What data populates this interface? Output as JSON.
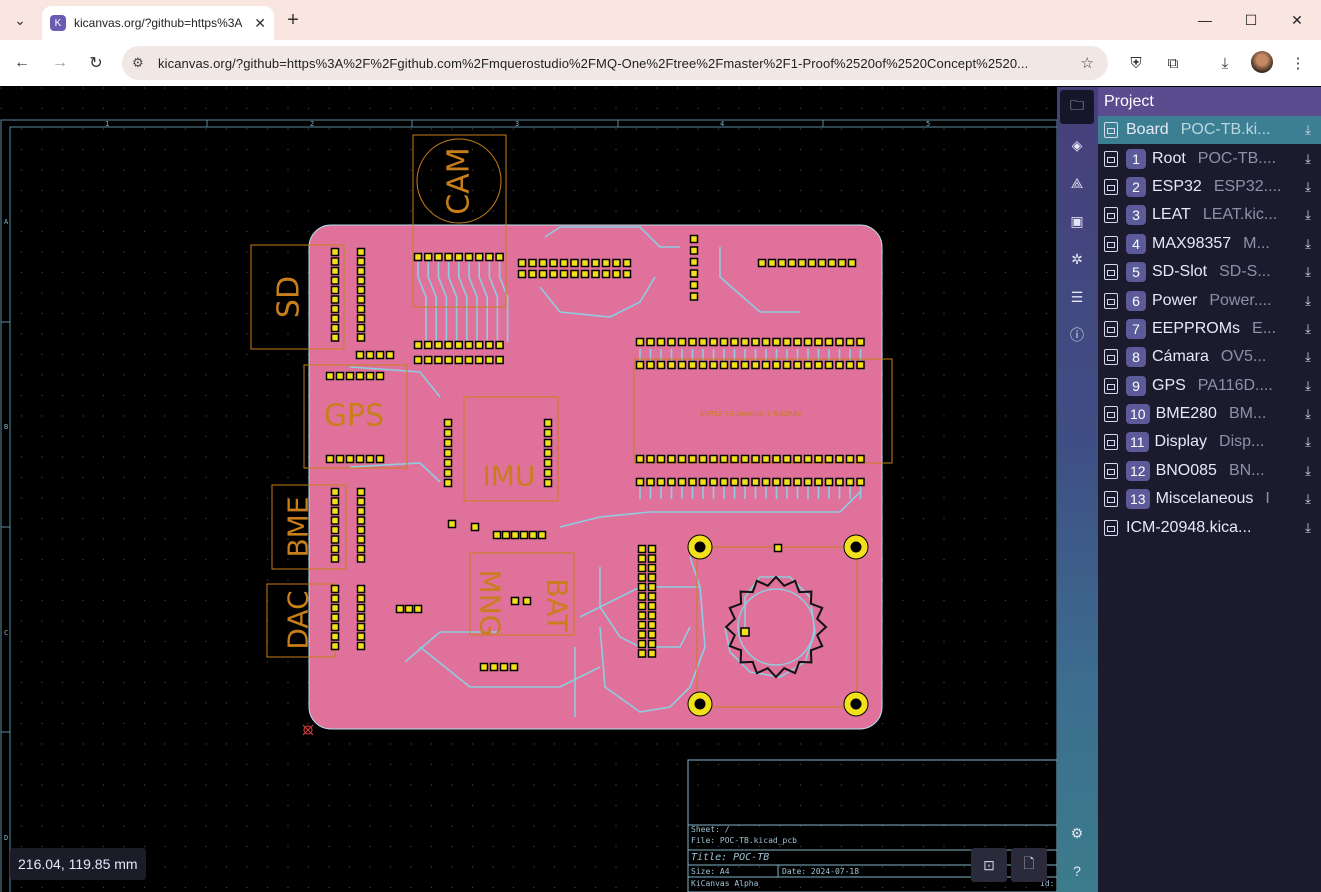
{
  "browser": {
    "tab_title": "kicanvas.org/?github=https%3A",
    "tab_favicon": "K",
    "url": "kicanvas.org/?github=https%3A%2F%2Fgithub.com%2Fmquerostudio%2FMQ-One%2Ftree%2Fmaster%2F1-Proof%2520of%2520Concept%2520...",
    "new_tab_label": "+"
  },
  "board": {
    "silkscreen_labels": {
      "cam": "CAM",
      "sd": "SD",
      "gps": "GPS",
      "imu": "IMU",
      "bme": "BME",
      "dac": "DAC",
      "mng": "MNG",
      "bat": "BAT",
      "esp": "ESP32-S3-DevKitC-1-N32R8V"
    },
    "frame_cols": [
      "1",
      "2",
      "3",
      "4",
      "5"
    ],
    "frame_rows": [
      "A",
      "B",
      "C",
      "D"
    ],
    "colors": {
      "board_fill": "#e0719a",
      "courtyard": "#c87e1a",
      "pad": "#f2e01a",
      "trace": "#8ecde0",
      "frame": "#7fb3c8"
    }
  },
  "title_block": {
    "sheet": "Sheet: /",
    "file": "File: POC-TB.kicad_pcb",
    "title": "Title: POC-TB",
    "size": "Size: A4",
    "date": "Date: 2024-07-18",
    "app": "KiCanvas Alpha",
    "id": "Id:"
  },
  "status": {
    "coordinates": "216.04, 119.85 mm"
  },
  "panel": {
    "header": "Project",
    "rows": [
      {
        "num": "",
        "name": "Board",
        "file": "POC-TB.ki..."
      },
      {
        "num": "1",
        "name": "Root",
        "file": "POC-TB...."
      },
      {
        "num": "2",
        "name": "ESP32",
        "file": "ESP32...."
      },
      {
        "num": "3",
        "name": "LEAT",
        "file": "LEAT.kic..."
      },
      {
        "num": "4",
        "name": "MAX98357",
        "file": "M..."
      },
      {
        "num": "5",
        "name": "SD-Slot",
        "file": "SD-S..."
      },
      {
        "num": "6",
        "name": "Power",
        "file": "Power...."
      },
      {
        "num": "7",
        "name": "EEPPROMs",
        "file": "E..."
      },
      {
        "num": "8",
        "name": "Cámara",
        "file": "OV5..."
      },
      {
        "num": "9",
        "name": "GPS",
        "file": "PA116D...."
      },
      {
        "num": "10",
        "name": "BME280",
        "file": "BM..."
      },
      {
        "num": "11",
        "name": "Display",
        "file": "Disp..."
      },
      {
        "num": "12",
        "name": "BNO085",
        "file": "BN..."
      },
      {
        "num": "13",
        "name": "Miscelaneous",
        "file": "I"
      },
      {
        "num": "",
        "name": "ICM-20948.kica...",
        "file": ""
      }
    ]
  },
  "rail_icons": [
    "folder-icon",
    "layers-icon",
    "objects-icon",
    "footprint-icon",
    "nets-icon",
    "properties-icon",
    "info-icon"
  ],
  "rail_bottom_icons": [
    "settings-icon",
    "help-icon"
  ]
}
